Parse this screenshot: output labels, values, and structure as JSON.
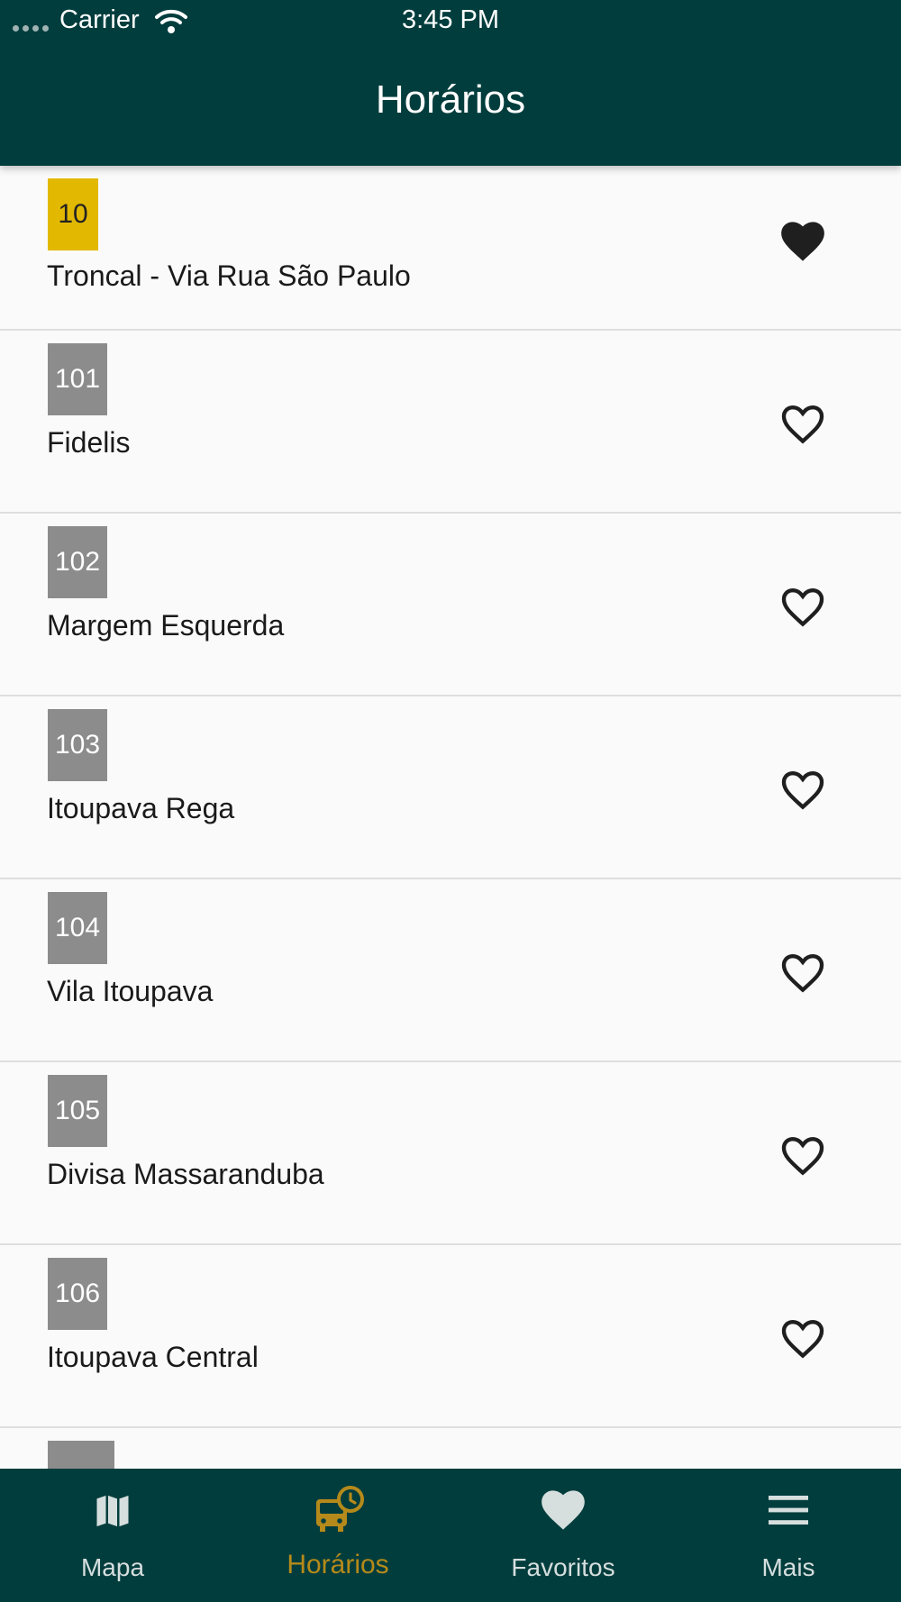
{
  "status_bar": {
    "carrier": "Carrier",
    "time": "3:45 PM"
  },
  "header": {
    "title": "Horários"
  },
  "routes": [
    {
      "number": "10",
      "name": "Troncal - Via Rua São Paulo",
      "favorite": true,
      "badge_color": "#e2b900"
    },
    {
      "number": "101",
      "name": "Fidelis",
      "favorite": false,
      "badge_color": "#8c8c8c"
    },
    {
      "number": "102",
      "name": "Margem Esquerda",
      "favorite": false,
      "badge_color": "#8c8c8c"
    },
    {
      "number": "103",
      "name": "Itoupava Rega",
      "favorite": false,
      "badge_color": "#8c8c8c"
    },
    {
      "number": "104",
      "name": "Vila Itoupava",
      "favorite": false,
      "badge_color": "#8c8c8c"
    },
    {
      "number": "105",
      "name": "Divisa Massaranduba",
      "favorite": false,
      "badge_color": "#8c8c8c"
    },
    {
      "number": "106",
      "name": "Itoupava Central",
      "favorite": false,
      "badge_color": "#8c8c8c"
    }
  ],
  "tabs": [
    {
      "label": "Mapa",
      "icon": "map-icon",
      "active": false
    },
    {
      "label": "Horários",
      "icon": "bus-clock-icon",
      "active": true
    },
    {
      "label": "Favoritos",
      "icon": "heart-icon",
      "active": false
    },
    {
      "label": "Mais",
      "icon": "menu-icon",
      "active": false
    }
  ],
  "colors": {
    "header_bg": "#023d3d",
    "active_tab": "#b58a1a",
    "featured_badge": "#e2b900",
    "badge": "#8c8c8c"
  }
}
